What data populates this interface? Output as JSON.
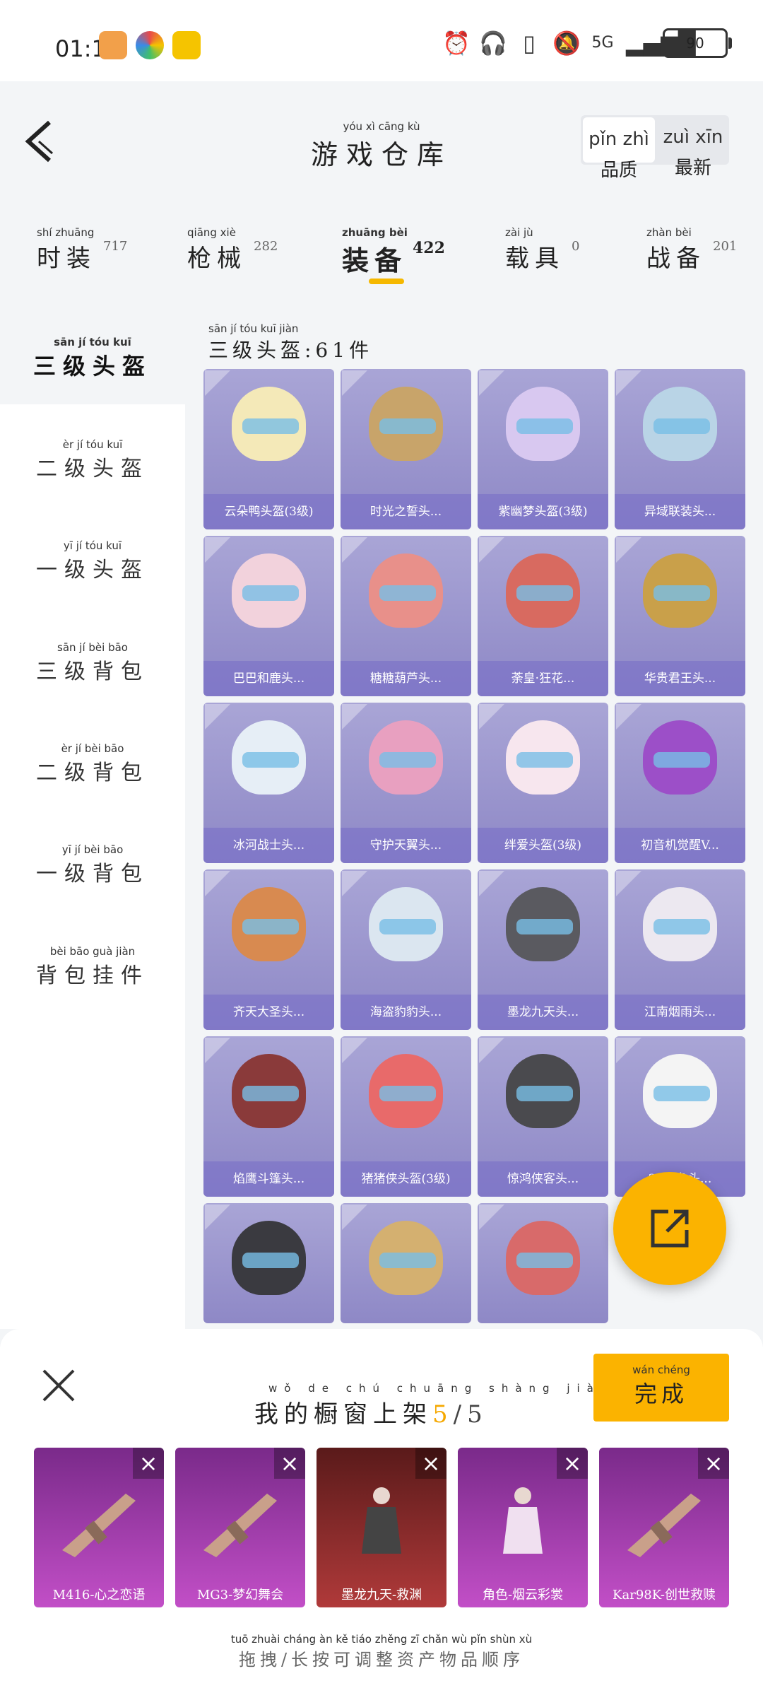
{
  "status_bar": {
    "time": "01:11",
    "battery": "90",
    "network": "5G"
  },
  "header": {
    "title": "游戏仓库",
    "title_pinyin": "yóu xì cāng kù",
    "sort": [
      {
        "label": "品质",
        "pinyin": "pǐn zhì",
        "selected": true
      },
      {
        "label": "最新",
        "pinyin": "zuì xīn",
        "selected": false
      }
    ]
  },
  "tabs": [
    {
      "label": "时装",
      "pinyin": "shí zhuāng",
      "count": "717"
    },
    {
      "label": "枪械",
      "pinyin": "qiāng xiè",
      "count": "282"
    },
    {
      "label": "装备",
      "pinyin": "zhuāng bèi",
      "count": "422",
      "active": true
    },
    {
      "label": "载具",
      "pinyin": "zài jù",
      "count": "0"
    },
    {
      "label": "战备",
      "pinyin": "zhàn bèi",
      "count": "201"
    }
  ],
  "sidebar": [
    {
      "label": "三级头盔",
      "pinyin": "sān jí tóu kuī",
      "selected": true
    },
    {
      "label": "二级头盔",
      "pinyin": "èr jí tóu kuī"
    },
    {
      "label": "一级头盔",
      "pinyin": "yī jí tóu kuī"
    },
    {
      "label": "三级背包",
      "pinyin": "sān jí bèi bāo"
    },
    {
      "label": "二级背包",
      "pinyin": "èr jí bèi bāo"
    },
    {
      "label": "一级背包",
      "pinyin": "yī jí bèi bāo"
    },
    {
      "label": "背包挂件",
      "pinyin": "bèi bāo guà jiàn"
    }
  ],
  "section": {
    "title": "三级头盔:61件",
    "pinyin": "sān jí tóu kuī jiàn"
  },
  "items": [
    {
      "name": "云朵鸭头盔(3级)",
      "color": "#f4e9b8"
    },
    {
      "name": "时光之誓头...",
      "color": "#c8a46a"
    },
    {
      "name": "紫幽梦头盔(3级)",
      "color": "#d8c8f0"
    },
    {
      "name": "异域联装头...",
      "color": "#b9d4e6"
    },
    {
      "name": "巴巴和鹿头...",
      "color": "#f2d2dc"
    },
    {
      "name": "糖糖葫芦头...",
      "color": "#e8908a"
    },
    {
      "name": "荼皇·狂花...",
      "color": "#d86a60"
    },
    {
      "name": "华贵君王头...",
      "color": "#c9a04a"
    },
    {
      "name": "冰河战士头...",
      "color": "#e6eef6"
    },
    {
      "name": "守护天翼头...",
      "color": "#e8a0c0"
    },
    {
      "name": "绊爱头盔(3级)",
      "color": "#f7e6ee"
    },
    {
      "name": "初音机觉醒V...",
      "color": "#9c4fc8"
    },
    {
      "name": "齐天大圣头...",
      "color": "#d88a50"
    },
    {
      "name": "海盗豹豹头...",
      "color": "#dbe6f0"
    },
    {
      "name": "墨龙九天头...",
      "color": "#5a5a60"
    },
    {
      "name": "江南烟雨头...",
      "color": "#ece8f0"
    },
    {
      "name": "焰鹰斗篷头...",
      "color": "#8a3a3a"
    },
    {
      "name": "猪猪侠头盔(3级)",
      "color": "#e86a6a"
    },
    {
      "name": "惊鸿侠客头...",
      "color": "#4a4a4e"
    },
    {
      "name": "2P角色头...",
      "color": "#f4f4f4"
    },
    {
      "name": "",
      "color": "#3a3a40"
    },
    {
      "name": "",
      "color": "#d4b070"
    },
    {
      "name": "",
      "color": "#d86a6a"
    }
  ],
  "showcase": {
    "title": "我的橱窗上架",
    "title_pinyin": "wǒ de chú chuāng shàng jià",
    "count_current": "5",
    "count_total": "/5",
    "done_label": "完成",
    "done_pinyin": "wán chéng",
    "slots": [
      {
        "name": "M416-心之恋语",
        "type": "rifle"
      },
      {
        "name": "MG3-梦幻舞会",
        "type": "rifle"
      },
      {
        "name": "墨龙九天-救渊",
        "type": "character"
      },
      {
        "name": "角色-烟云彩裳",
        "type": "character"
      },
      {
        "name": "Kar98K-创世救赎",
        "type": "rifle"
      }
    ],
    "hint": "拖拽/长按可调整资产物品顺序",
    "hint_pinyin": "tuō zhuài cháng àn kě tiáo zhěng zī chǎn wù pǐn shùn xù"
  },
  "colors": {
    "accent": "#fbb300",
    "card": "#a9a5d6",
    "slot": "#b84bbf"
  }
}
